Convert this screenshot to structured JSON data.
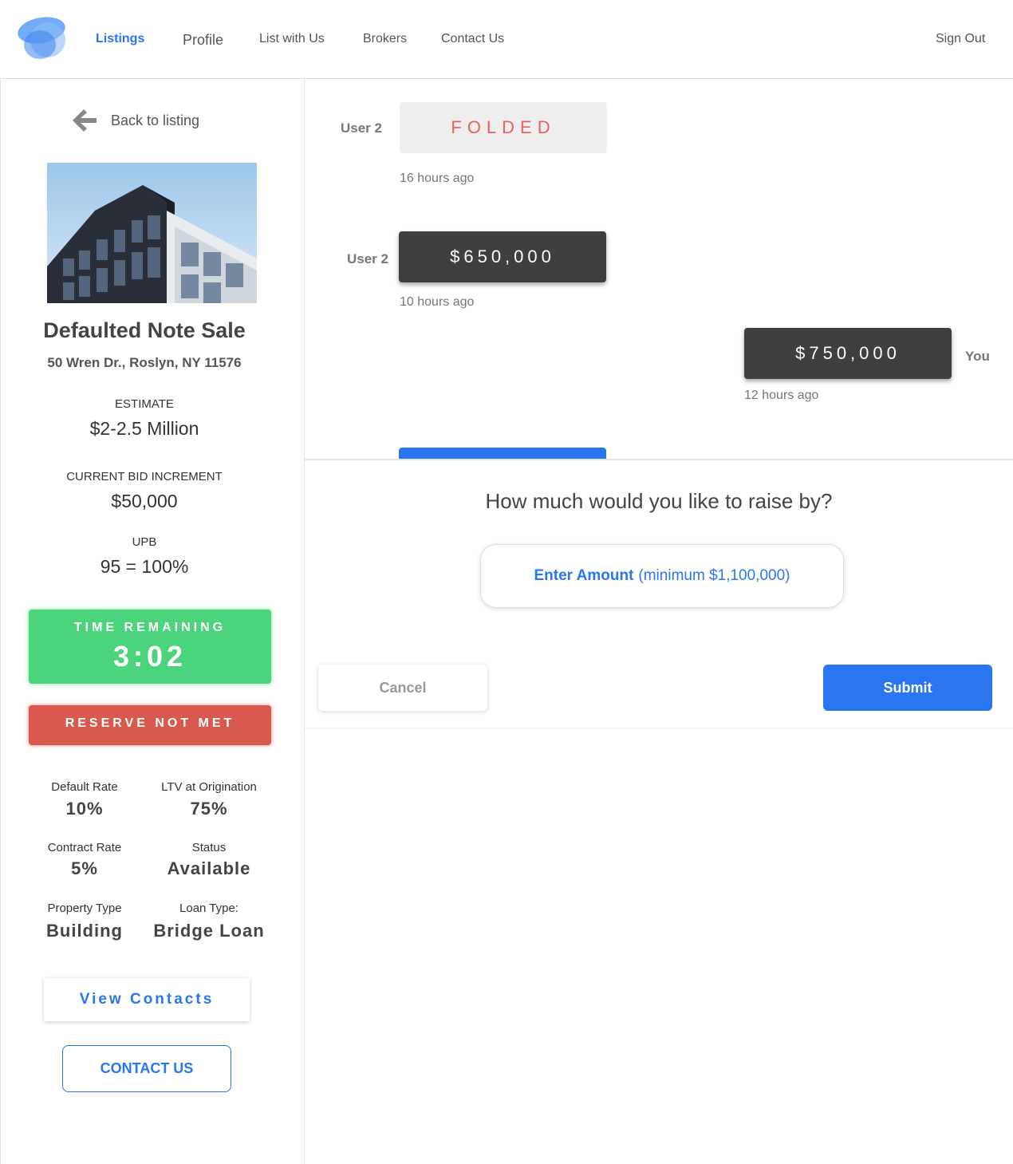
{
  "nav": {
    "items": [
      {
        "label": "Listings",
        "active": true
      },
      {
        "label": "Profile"
      },
      {
        "label": "List with Us"
      },
      {
        "label": "Brokers"
      },
      {
        "label": "Contact Us"
      }
    ],
    "sign_out": "Sign Out",
    "accent": "#2a76f0"
  },
  "listing": {
    "back_label": "Back to listing",
    "title": "Defaulted Note Sale",
    "address": "50 Wren Dr., Roslyn, NY 11576",
    "estimate_label": "ESTIMATE",
    "estimate_value": "$2-2.5 Million",
    "increment_label": "CURRENT BID INCREMENT",
    "increment_value": "$50,000",
    "upb_label": "UPB",
    "upb_value": "95 = 100%",
    "timer_label": "TIME REMAINING",
    "timer_value": "3:02",
    "reserve_label": "RESERVE NOT MET",
    "details": [
      {
        "label": "Default Rate",
        "value": "10%"
      },
      {
        "label": "LTV at Origination",
        "value": "75%"
      },
      {
        "label": "Contract Rate",
        "value": "5%"
      },
      {
        "label": "Status",
        "value": "Available"
      },
      {
        "label": "Property Type",
        "value": "Building"
      },
      {
        "label": "Loan Type:",
        "value": "Bridge Loan"
      }
    ],
    "view_contacts": "View Contacts",
    "contact_us": "CONTACT US"
  },
  "bids": [
    {
      "user": "User 2",
      "value": "FOLDED",
      "time": "16 hours ago"
    },
    {
      "user": "User 2",
      "value": "$650,000",
      "time": "10 hours ago"
    },
    {
      "user": "You",
      "value": "$750,000",
      "time": "12 hours ago"
    }
  ],
  "raise": {
    "question": "How much would you like to raise by?",
    "input_bold": "Enter Amount",
    "input_hint": "(minimum $1,100,000)",
    "cancel": "Cancel",
    "submit": "Submit"
  },
  "colors": {
    "timer": "#4cd47d",
    "reserve": "#d85a4f",
    "folded_text": "#e8615a",
    "bid_bg": "#3f3f3f"
  }
}
